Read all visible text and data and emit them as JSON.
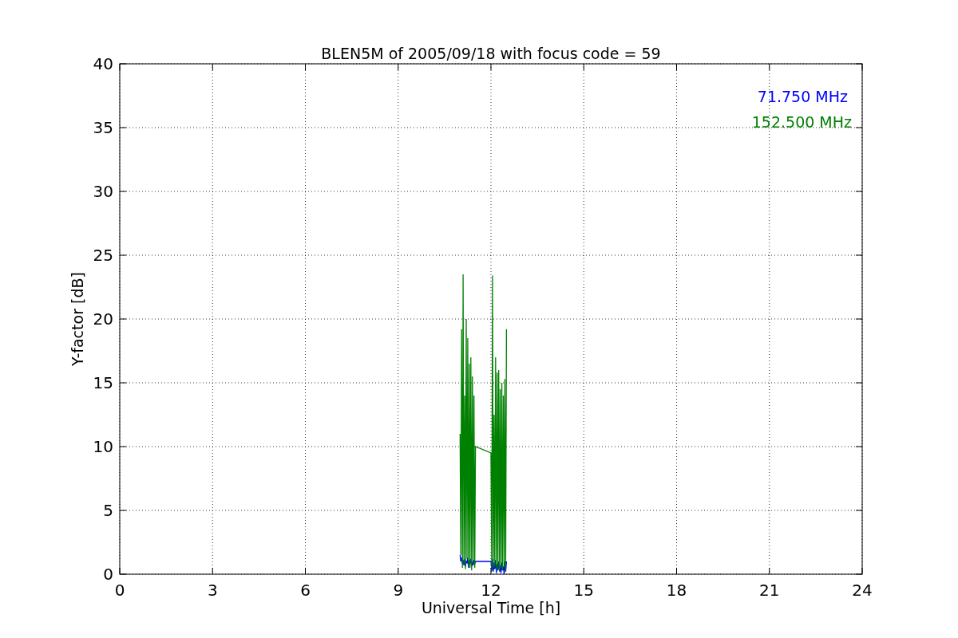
{
  "figure": {
    "chart_data": {
      "type": "line",
      "grid": true,
      "title": "BLEN5M of 2005/09/18 with focus code = 59",
      "xlabel": "Universal Time [h]",
      "ylabel": "Y-factor [dB]",
      "xlim": [
        0,
        24
      ],
      "ylim": [
        0,
        40
      ],
      "xticks": [
        0,
        3,
        6,
        9,
        12,
        15,
        18,
        21,
        24
      ],
      "yticks": [
        0,
        5,
        10,
        15,
        20,
        25,
        30,
        35,
        40
      ],
      "x": [
        11.0,
        11.025,
        11.05,
        11.075,
        11.1,
        11.125,
        11.15,
        11.175,
        11.2,
        11.225,
        11.25,
        11.275,
        11.3,
        11.325,
        11.35,
        11.375,
        11.4,
        11.425,
        11.45,
        11.475,
        11.5,
        12.0,
        12.025,
        12.05,
        12.075,
        12.1,
        12.125,
        12.15,
        12.175,
        12.2,
        12.225,
        12.25,
        12.275,
        12.3,
        12.325,
        12.35,
        12.375,
        12.4,
        12.425,
        12.45,
        12.475,
        12.5
      ],
      "series": [
        {
          "name": "71.750 MHz",
          "color": "#0000ff",
          "values": [
            1.5,
            1.0,
            1.3,
            0.8,
            1.1,
            0.7,
            1.2,
            0.6,
            1.0,
            0.9,
            1.3,
            0.5,
            1.1,
            0.8,
            1.2,
            0.6,
            1.0,
            0.7,
            1.1,
            0.8,
            1.0,
            1.0,
            0.3,
            1.2,
            0.2,
            0.9,
            0.4,
            1.1,
            0.1,
            0.8,
            0.3,
            1.0,
            0.2,
            0.7,
            0.1,
            0.9,
            0.3,
            0.6,
            0.0,
            1.0,
            0.2,
            1.0
          ]
        },
        {
          "name": "152.500 MHz",
          "color": "#008000",
          "values": [
            11,
            1.5,
            19.2,
            0.5,
            23.5,
            0.8,
            14,
            0.4,
            20,
            1.2,
            18.5,
            0.6,
            16.5,
            0.5,
            17,
            0.3,
            15.5,
            0.8,
            14,
            0.5,
            10,
            9.5,
            0.2,
            23.4,
            0.5,
            12.5,
            0.6,
            17,
            0.3,
            15.8,
            0.4,
            16,
            0.2,
            14.5,
            0.5,
            15,
            0.3,
            14,
            0.6,
            15.3,
            0.2,
            19.2
          ]
        }
      ]
    }
  }
}
